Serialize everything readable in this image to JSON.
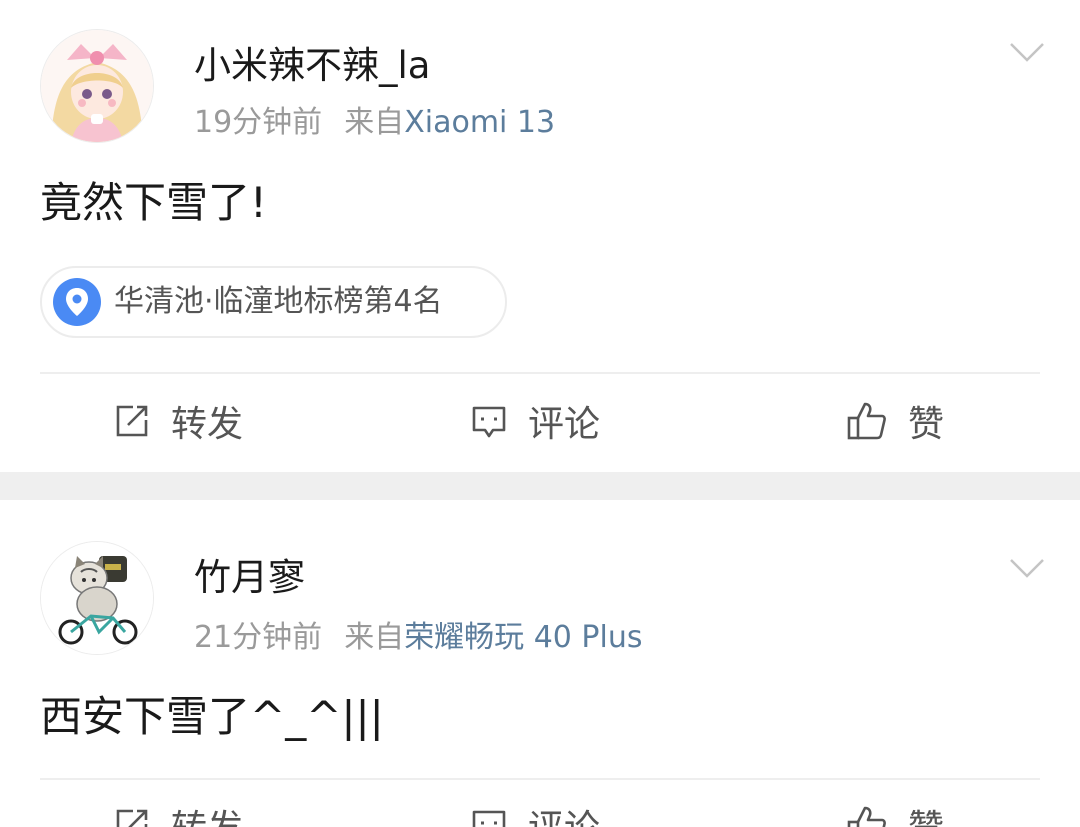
{
  "posts": [
    {
      "username": "小米辣不辣_la",
      "time": "19分钟前",
      "from_label": "来自",
      "device": "Xiaomi 13",
      "text": "竟然下雪了!",
      "location": {
        "name": "华清池",
        "ranking": "·临潼地标榜第4名",
        "icon": "location-pin-icon"
      },
      "actions": {
        "repost": "转发",
        "comment": "评论",
        "like": "赞"
      },
      "avatar": "anime-girl-avatar"
    },
    {
      "username": "竹月寥",
      "time": "21分钟前",
      "from_label": "来自",
      "device": "荣耀畅玩 40 Plus",
      "text": "西安下雪了^_^|||",
      "actions": {
        "repost": "转发",
        "comment": "评论",
        "like": "赞"
      },
      "avatar": "cat-on-bicycle-avatar"
    }
  ],
  "colors": {
    "link_blue": "#5c7d9c",
    "location_pin": "#4a8af4",
    "separator": "#efefef",
    "meta_gray": "#9a9a9a"
  }
}
